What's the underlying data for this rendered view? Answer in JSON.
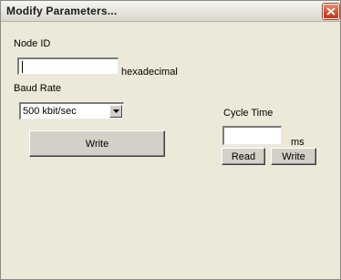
{
  "window": {
    "title": "Modify Parameters..."
  },
  "node_id": {
    "label": "Node ID",
    "value": "",
    "unit": "hexadecimal"
  },
  "baud_rate": {
    "label": "Baud Rate",
    "selected": "500 kbit/sec",
    "write_label": "Write"
  },
  "cycle_time": {
    "label": "Cycle Time",
    "value": "",
    "unit": "ms",
    "read_label": "Read",
    "write_label": "Write"
  },
  "icons": {
    "close": "close-icon",
    "dropdown": "chevron-down-icon"
  },
  "colors": {
    "close_button": "#d8462a",
    "dialog_bg": "#ece9d8"
  }
}
